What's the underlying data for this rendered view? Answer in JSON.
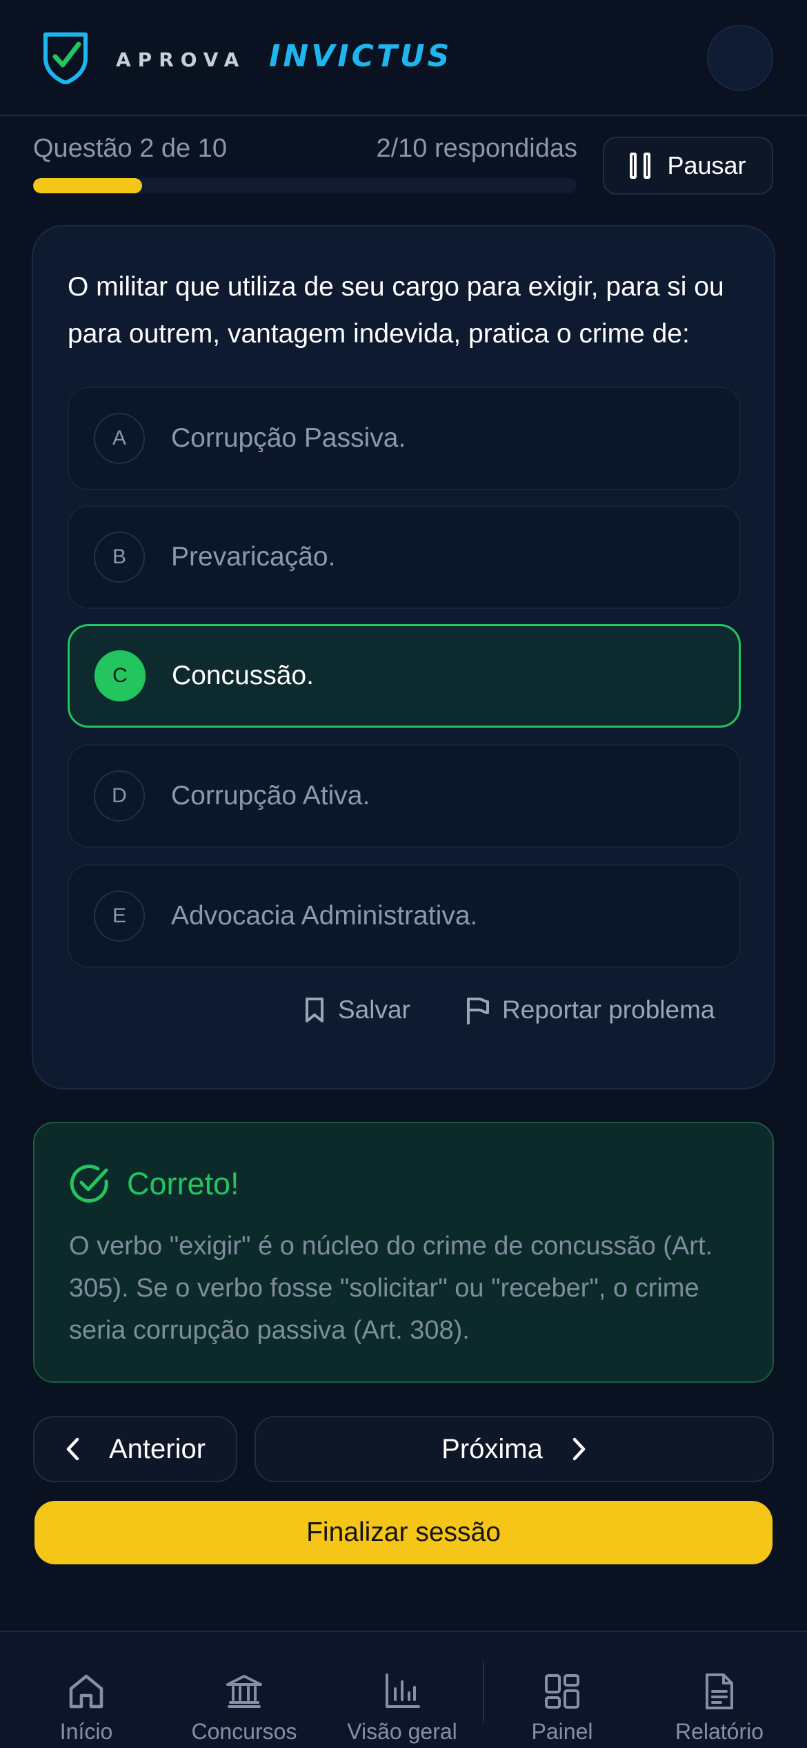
{
  "header": {
    "brand_prefix": "APROVA",
    "brand_name": "INVICTUS"
  },
  "progress": {
    "question_label": "Questão 2 de 10",
    "answered_label": "2/10 respondidas",
    "fraction": 0.2,
    "pause_label": "Pausar"
  },
  "question": {
    "text": "O militar que utiliza de seu cargo para exigir, para si ou para outrem, vantagem indevida, pratica o crime de:",
    "options": [
      {
        "letter": "A",
        "text": "Corrupção Passiva.",
        "selected": false
      },
      {
        "letter": "B",
        "text": "Prevaricação.",
        "selected": false
      },
      {
        "letter": "C",
        "text": "Concussão.",
        "selected": true
      },
      {
        "letter": "D",
        "text": "Corrupção Ativa.",
        "selected": false
      },
      {
        "letter": "E",
        "text": "Advocacia Administrativa.",
        "selected": false
      }
    ],
    "save_label": "Salvar",
    "report_label": "Reportar problema"
  },
  "feedback": {
    "title": "Correto!",
    "text": "O verbo \"exigir\" é o núcleo do crime de concussão (Art. 305). Se o verbo fosse \"solicitar\" ou \"receber\", o crime seria corrupção passiva (Art. 308)."
  },
  "navigation": {
    "prev_label": "Anterior",
    "next_label": "Próxima",
    "finish_label": "Finalizar sessão"
  },
  "bottom_nav": {
    "items": [
      {
        "label": "Início",
        "icon": "home-icon"
      },
      {
        "label": "Concursos",
        "icon": "bank-icon"
      },
      {
        "label": "Visão geral",
        "icon": "bar-chart-icon"
      },
      {
        "label": "Painel",
        "icon": "dashboard-icon"
      },
      {
        "label": "Relatório",
        "icon": "document-icon"
      }
    ]
  },
  "colors": {
    "accent_yellow": "#f5c518",
    "success_green": "#22c55e",
    "brand_blue": "#1fb6f0",
    "background": "#0a1221"
  }
}
